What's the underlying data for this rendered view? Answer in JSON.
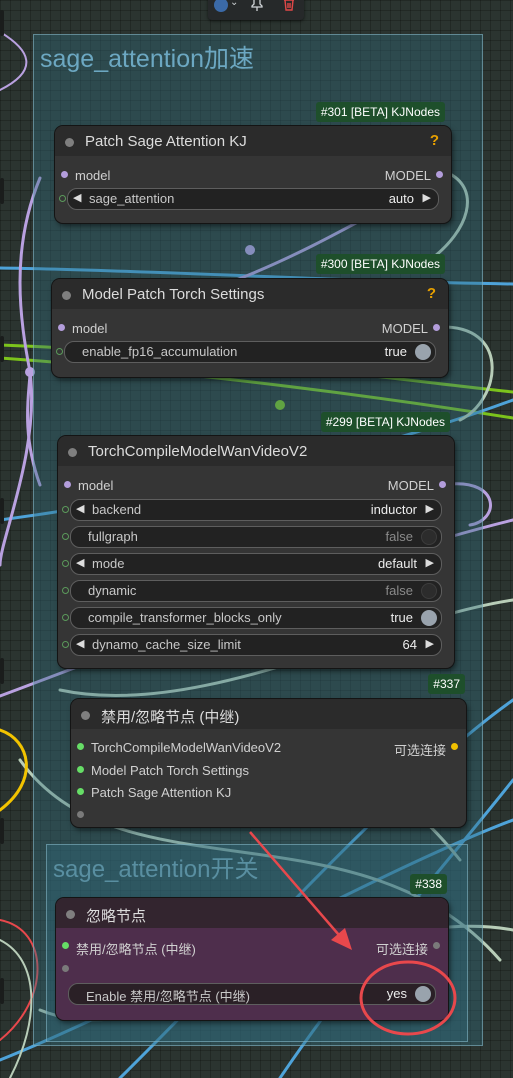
{
  "toolbar": {
    "color_icon": "color-swatch-icon",
    "pin_icon": "pin-icon",
    "delete_icon": "trash-icon"
  },
  "groups": {
    "main": {
      "title": "sage_attention加速"
    },
    "switch": {
      "title": "sage_attention开关"
    }
  },
  "nodes": {
    "n301": {
      "badge": "#301 [BETA] KJNodes",
      "title": "Patch Sage Attention KJ",
      "help": "?",
      "input": "model",
      "output": "MODEL",
      "widget": {
        "name": "sage_attention",
        "value": "auto"
      }
    },
    "n300": {
      "badge": "#300 [BETA] KJNodes",
      "title": "Model Patch Torch Settings",
      "help": "?",
      "input": "model",
      "output": "MODEL",
      "widget": {
        "name": "enable_fp16_accumulation",
        "value": "true"
      }
    },
    "n299": {
      "badge": "#299 [BETA] KJNodes",
      "title": "TorchCompileModelWanVideoV2",
      "input": "model",
      "output": "MODEL",
      "widgets": [
        {
          "name": "backend",
          "value": "inductor"
        },
        {
          "name": "fullgraph",
          "value": "false"
        },
        {
          "name": "mode",
          "value": "default"
        },
        {
          "name": "dynamic",
          "value": "false"
        },
        {
          "name": "compile_transformer_blocks_only",
          "value": "true"
        },
        {
          "name": "dynamo_cache_size_limit",
          "value": "64"
        }
      ]
    },
    "n337": {
      "badge": "#337",
      "title": "禁用/忽略节点 (中继)",
      "inputs": [
        "TorchCompileModelWanVideoV2",
        "Model Patch Torch Settings",
        "Patch Sage Attention KJ"
      ],
      "output": "可选连接"
    },
    "n338": {
      "badge": "#338",
      "title": "忽略节点",
      "input": "禁用/忽略节点 (中继)",
      "output": "可选连接",
      "widget": {
        "name": "Enable 禁用/忽略节点 (中继)",
        "value": "yes"
      }
    }
  },
  "colors": {
    "model_socket": "#b39ddb",
    "relay_socket": "#66dd66",
    "opt_socket": "#f0c000",
    "wire_blue": "#4ea3d9",
    "wire_green": "#7cc31c",
    "wire_purple": "#b9a1e0",
    "wire_white": "#b8cdb8",
    "wire_yellow": "#f2c300",
    "annotation_red": "#e8484c",
    "badge_bg": "#1e4f2b",
    "help_icon": "#e8a000"
  }
}
